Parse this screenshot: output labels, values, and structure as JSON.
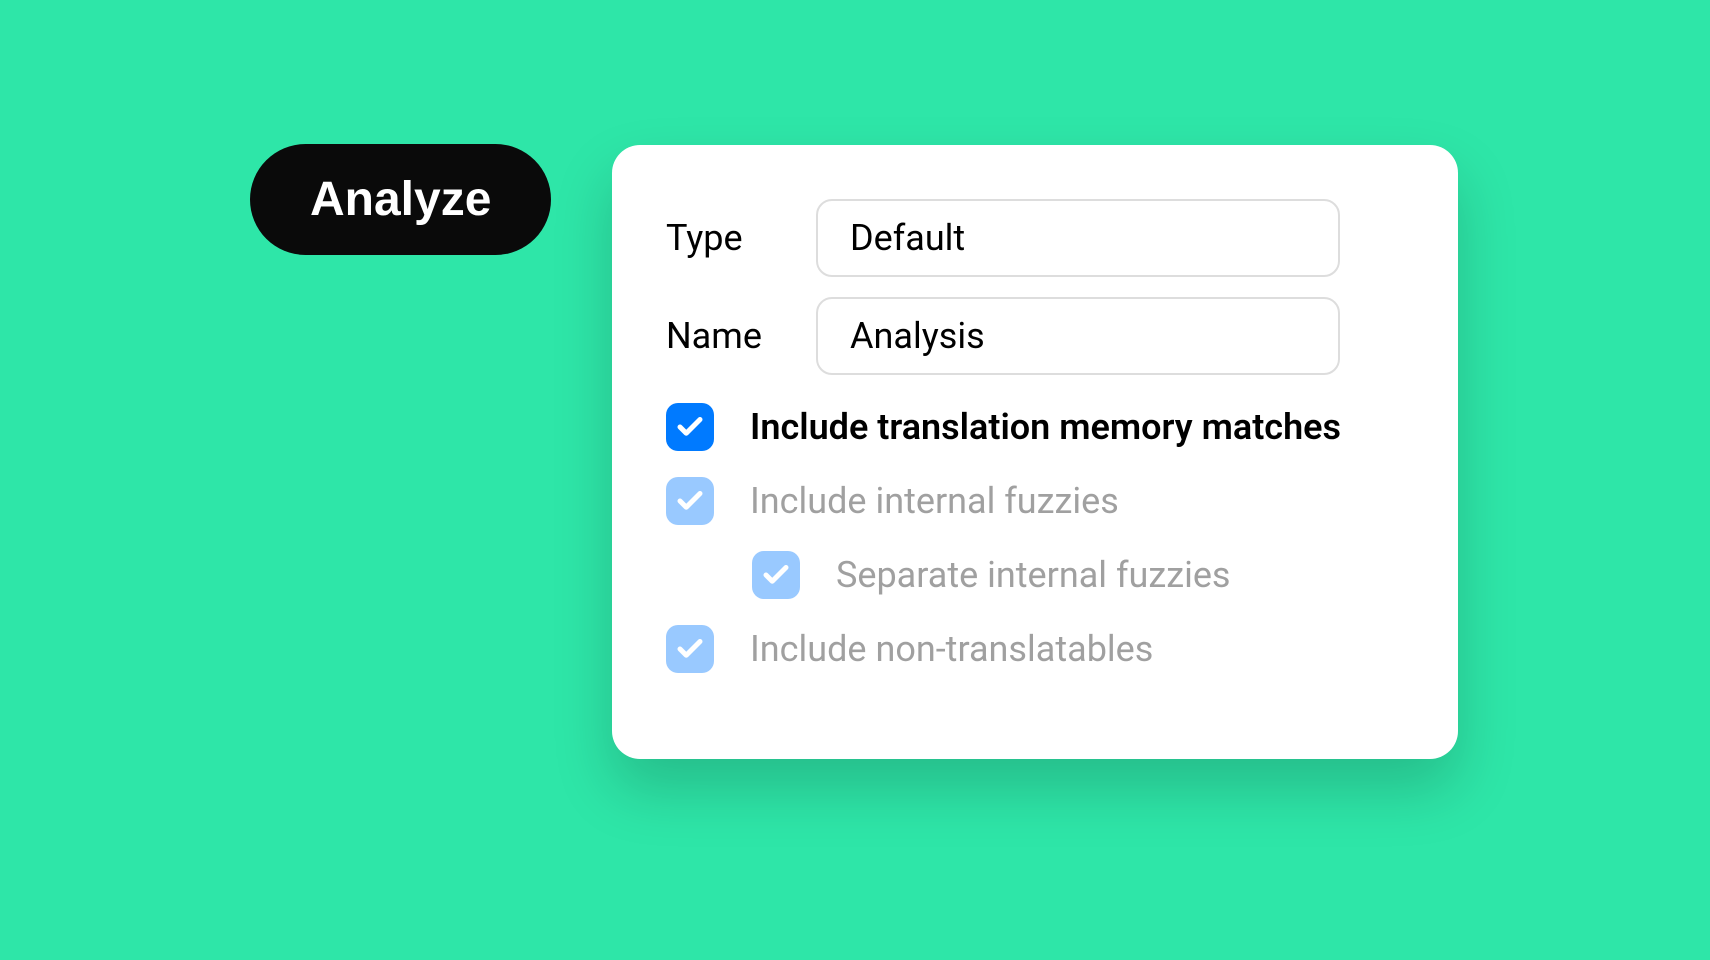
{
  "button": {
    "label": "Analyze"
  },
  "form": {
    "type_label": "Type",
    "type_value": "Default",
    "name_label": "Name",
    "name_value": "Analysis"
  },
  "checkboxes": {
    "tm_matches": {
      "label": "Include translation memory matches",
      "checked": true,
      "enabled": true
    },
    "internal_fuzzies": {
      "label": "Include internal fuzzies",
      "checked": true,
      "enabled": false
    },
    "separate_fuzzies": {
      "label": "Separate internal fuzzies",
      "checked": true,
      "enabled": false
    },
    "non_translatables": {
      "label": "Include non-translatables",
      "checked": true,
      "enabled": false
    }
  }
}
